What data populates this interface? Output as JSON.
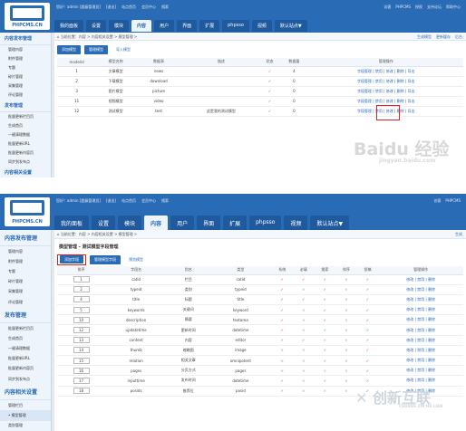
{
  "brand": {
    "logo_text": "PHPCMS.CN"
  },
  "top_info": [
    "您好！admin [超级管理员]",
    "[退出]",
    "站点首页",
    "会员中心",
    "搜索"
  ],
  "top_right_1": [
    "访客",
    "PHPCMS",
    "授权",
    "支持论坛",
    "帮助中心"
  ],
  "top_right_2": [
    "访客",
    "PHPCMS"
  ],
  "nav": [
    "我的面板",
    "设置",
    "模块",
    "内容",
    "用户",
    "界面",
    "扩展",
    "phpsso",
    "视频",
    "默认站点▼"
  ],
  "sidebar1": [
    {
      "type": "sec",
      "label": "内容发布管理"
    },
    {
      "type": "li",
      "label": "管理内容"
    },
    {
      "type": "li",
      "label": "附件管理"
    },
    {
      "type": "li",
      "label": "专题"
    },
    {
      "type": "li",
      "label": "碎片管理"
    },
    {
      "type": "li",
      "label": "采集管理"
    },
    {
      "type": "li",
      "label": "评论管理"
    },
    {
      "type": "sec",
      "label": "发布管理"
    },
    {
      "type": "li",
      "label": "批量更新栏目页"
    },
    {
      "type": "li",
      "label": "生成首页"
    },
    {
      "type": "li",
      "label": "一键清理数据"
    },
    {
      "type": "li",
      "label": "批量更新URL"
    },
    {
      "type": "li",
      "label": "批量更新内容页"
    },
    {
      "type": "li",
      "label": "同步到发布点"
    },
    {
      "type": "sec",
      "label": "内容相关设置"
    },
    {
      "type": "li",
      "label": "管理栏目"
    },
    {
      "type": "li",
      "label": "模型管理"
    }
  ],
  "sidebar2": [
    {
      "type": "sec",
      "label": "内容发布管理"
    },
    {
      "type": "li",
      "label": "管理内容"
    },
    {
      "type": "li",
      "label": "附件管理"
    },
    {
      "type": "li",
      "label": "专题"
    },
    {
      "type": "li",
      "label": "碎片管理"
    },
    {
      "type": "li",
      "label": "采集管理"
    },
    {
      "type": "li",
      "label": "评论管理"
    },
    {
      "type": "sec",
      "label": "发布管理"
    },
    {
      "type": "li",
      "label": "批量更新栏目页"
    },
    {
      "type": "li",
      "label": "生成首页"
    },
    {
      "type": "li",
      "label": "一键清理数据"
    },
    {
      "type": "li",
      "label": "批量更新URL"
    },
    {
      "type": "li",
      "label": "批量更新内容页"
    },
    {
      "type": "li",
      "label": "同步到发布点"
    },
    {
      "type": "sec",
      "label": "内容相关设置"
    },
    {
      "type": "li",
      "label": "管理栏目"
    },
    {
      "type": "li",
      "label": "• 模型管理"
    },
    {
      "type": "li",
      "label": "类别管理"
    },
    {
      "type": "li",
      "label": "推荐位管理"
    }
  ],
  "crumb1": "当前位置：内容 > 内容相关设置 > 模型管理 >",
  "crumb1_right": [
    "生成模型",
    "更新缓存",
    "后台"
  ],
  "crumb2": "当前位置：内容 > 内容相关设置 > 模型管理 >",
  "crumb2_right": "生成",
  "toolbar1": [
    "添加模型",
    "管理模型",
    "导入模型"
  ],
  "subtitle2": "模型管理 - 测试模型字段管理",
  "toolbar2": [
    "添加字段",
    "管理模型字段",
    "预览模型"
  ],
  "table1": {
    "headers": [
      "modelid",
      "模型名称",
      "数据表",
      "描述",
      "状态",
      "数据量",
      "管理操作"
    ],
    "rows": [
      [
        "1",
        "文章模型",
        "news",
        "",
        "✓",
        "4",
        "字段管理 | 禁用 | 修改 | 删除 | 导出"
      ],
      [
        "2",
        "下载模型",
        "download",
        "",
        "✓",
        "0",
        "字段管理 | 禁用 | 修改 | 删除 | 导出"
      ],
      [
        "3",
        "图片模型",
        "picture",
        "",
        "✓",
        "0",
        "字段管理 | 禁用 | 修改 | 删除 | 导出"
      ],
      [
        "11",
        "视频模型",
        "video",
        "",
        "✓",
        "0",
        "字段管理 | 禁用 | 修改 | 删除 | 导出"
      ],
      [
        "12",
        "测试模型",
        "test",
        "这是我的测试模型",
        "✓",
        "0",
        "字段管理 | 禁用 | 修改 | 删除 | 导出"
      ]
    ]
  },
  "table2": {
    "headers": [
      "排序",
      "字段名",
      "别名",
      "类型",
      "系统",
      "必填",
      "搜索",
      "排序",
      "投稿",
      "管理操作"
    ],
    "rows": [
      [
        "1",
        "catid",
        "栏目",
        "catid",
        "✓",
        "✓",
        "✓",
        "×",
        "✓",
        "修改 | 禁用 | 删除"
      ],
      [
        "2",
        "typeid",
        "类别",
        "typeid",
        "✓",
        "×",
        "✓",
        "×",
        "✓",
        "修改 | 禁用 | 删除"
      ],
      [
        "4",
        "title",
        "标题",
        "title",
        "✓",
        "✓",
        "✓",
        "×",
        "✓",
        "修改 | 禁用 | 删除"
      ],
      [
        "5",
        "keywords",
        "关键词",
        "keyword",
        "✓",
        "×",
        "✓",
        "×",
        "✓",
        "修改 | 禁用 | 删除"
      ],
      [
        "10",
        "description",
        "摘要",
        "textarea",
        "✓",
        "×",
        "✓",
        "×",
        "✓",
        "修改 | 禁用 | 删除"
      ],
      [
        "12",
        "updatetime",
        "更新时间",
        "datetime",
        "✓",
        "×",
        "×",
        "×",
        "×",
        "修改 | 禁用 | 删除"
      ],
      [
        "13",
        "content",
        "内容",
        "editor",
        "×",
        "✓",
        "×",
        "×",
        "✓",
        "修改 | 禁用 | 删除"
      ],
      [
        "14",
        "thumb",
        "缩略图",
        "image",
        "×",
        "×",
        "×",
        "×",
        "✓",
        "修改 | 禁用 | 删除"
      ],
      [
        "15",
        "relation",
        "相关文章",
        "omnipotent",
        "×",
        "×",
        "×",
        "×",
        "✓",
        "修改 | 禁用 | 删除"
      ],
      [
        "16",
        "pages",
        "分页方式",
        "pages",
        "×",
        "×",
        "×",
        "×",
        "✓",
        "修改 | 禁用 | 删除"
      ],
      [
        "17",
        "inputtime",
        "发布时间",
        "datetime",
        "✓",
        "×",
        "×",
        "×",
        "×",
        "修改 | 禁用 | 删除"
      ],
      [
        "18",
        "posids",
        "推荐位",
        "posid",
        "×",
        "×",
        "×",
        "×",
        "✓",
        "修改 | 禁用 | 删除"
      ]
    ]
  },
  "watermark1": "Baidu 经验",
  "watermark1_sub": "jingyan.baidu.com",
  "watermark2": "创新互联",
  "watermark2_sub": "CHUANG XIN HU LIAN"
}
